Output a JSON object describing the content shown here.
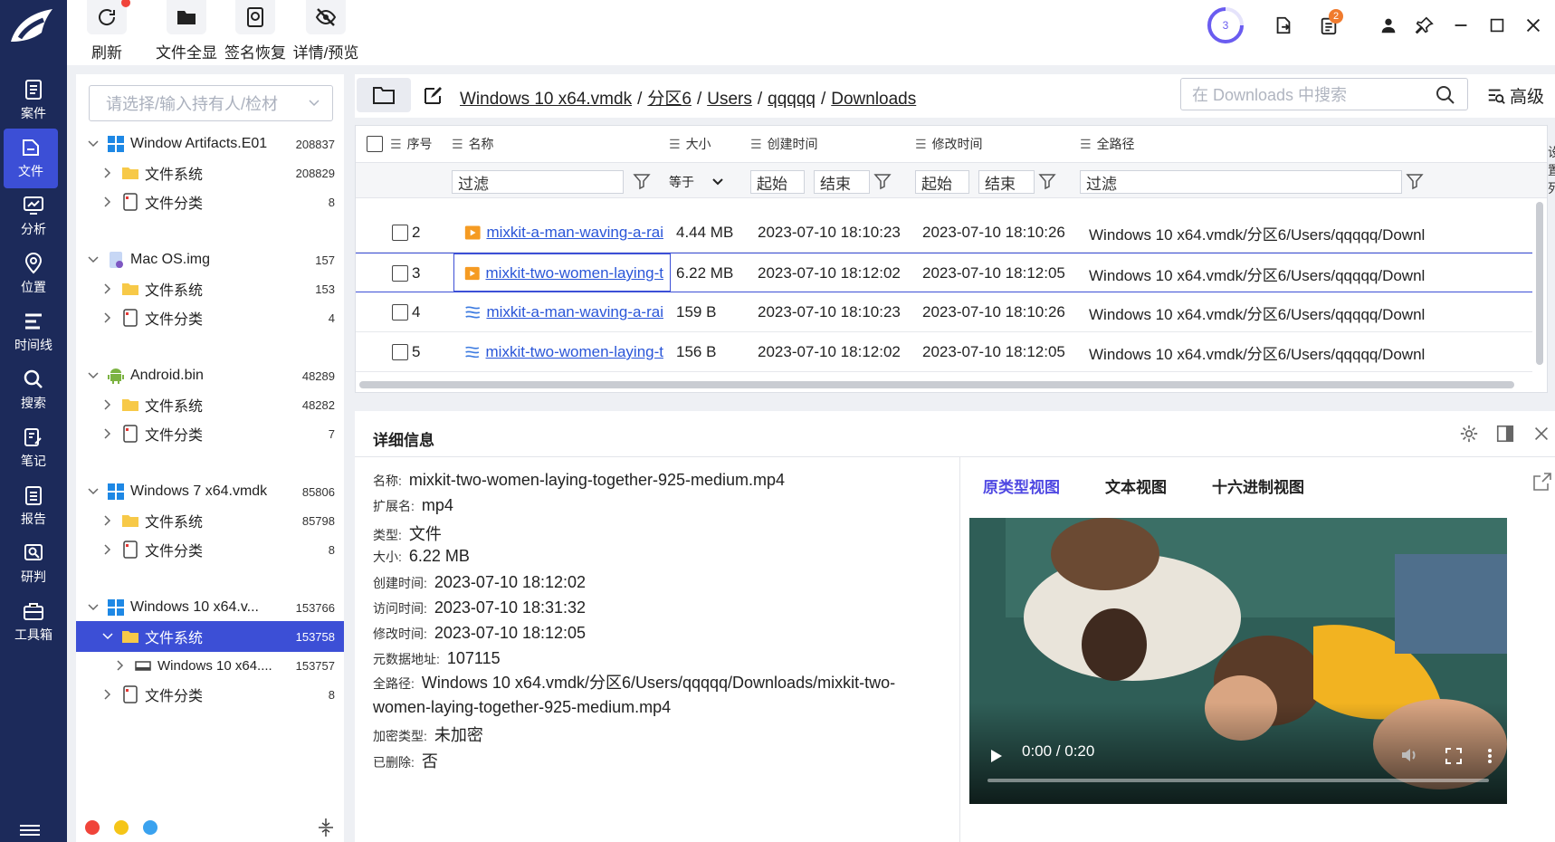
{
  "toolbar": {
    "refresh": "刷新",
    "file_full": "文件全显",
    "sign_restore": "签名恢复",
    "detail_preview": "详情/预览",
    "task_count": "3",
    "notify_count": "2"
  },
  "nav": {
    "items": [
      "案件",
      "文件",
      "分析",
      "位置",
      "时间线",
      "搜索",
      "笔记",
      "报告",
      "研判",
      "工具箱"
    ]
  },
  "tree": {
    "owner_placeholder": "请选择/输入持有人/检材",
    "nodes": [
      {
        "label": "Window Artifacts.E01",
        "count": "208837"
      },
      {
        "label": "文件系统",
        "count": "208829"
      },
      {
        "label": "文件分类",
        "count": "8"
      },
      {
        "label": "Mac OS.img",
        "count": "157"
      },
      {
        "label": "文件系统",
        "count": "153"
      },
      {
        "label": "文件分类",
        "count": "4"
      },
      {
        "label": "Android.bin",
        "count": "48289"
      },
      {
        "label": "文件系统",
        "count": "48282"
      },
      {
        "label": "文件分类",
        "count": "7"
      },
      {
        "label": "Windows 7 x64.vmdk",
        "count": "85806"
      },
      {
        "label": "文件系统",
        "count": "85798"
      },
      {
        "label": "文件分类",
        "count": "8"
      },
      {
        "label": "Windows 10 x64.v...",
        "count": "153766"
      },
      {
        "label": "文件系统",
        "count": "153758"
      },
      {
        "label": "Windows 10 x64....",
        "count": "153757"
      },
      {
        "label": "文件分类",
        "count": "8"
      }
    ]
  },
  "path": {
    "crumbs": [
      "Windows 10 x64.vmdk",
      "分区6",
      "Users",
      "qqqqq",
      "Downloads"
    ],
    "search_placeholder": "在 Downloads 中搜索",
    "advanced": "高级"
  },
  "table": {
    "headers": {
      "index": "序号",
      "name": "名称",
      "size": "大小",
      "created": "创建时间",
      "modified": "修改时间",
      "fullpath": "全路径"
    },
    "filter": {
      "placeholder": "过滤",
      "eq": "等于",
      "start": "起始",
      "end": "结束"
    },
    "rows": [
      {
        "index": "2",
        "name": "mixkit-a-man-waving-a-rai",
        "size": "4.44 MB",
        "created": "2023-07-10 18:10:23",
        "modified": "2023-07-10 18:10:26",
        "path": "Windows 10 x64.vmdk/分区6/Users/qqqqq/Downlo..."
      },
      {
        "index": "3",
        "name": "mixkit-two-women-laying-t",
        "size": "6.22 MB",
        "created": "2023-07-10 18:12:02",
        "modified": "2023-07-10 18:12:05",
        "path": "Windows 10 x64.vmdk/分区6/Users/qqqqq/Downlo..."
      },
      {
        "index": "4",
        "name": "mixkit-a-man-waving-a-rai",
        "size": "159 B",
        "created": "2023-07-10 18:10:23",
        "modified": "2023-07-10 18:10:26",
        "path": "Windows 10 x64.vmdk/分区6/Users/qqqqq/Downlo..."
      },
      {
        "index": "5",
        "name": "mixkit-two-women-laying-t",
        "size": "156 B",
        "created": "2023-07-10 18:12:02",
        "modified": "2023-07-10 18:12:05",
        "path": "Windows 10 x64.vmdk/分区6/Users/qqqqq/Downlo..."
      }
    ],
    "side_label": "设置列"
  },
  "detail": {
    "title": "详细信息",
    "name_k": "名称:",
    "name_v": "mixkit-two-women-laying-together-925-medium.mp4",
    "ext_k": "扩展名:",
    "ext_v": "mp4",
    "type_k": "类型:",
    "type_v": "文件",
    "size_k": "大小:",
    "size_v": "6.22 MB",
    "created_k": "创建时间:",
    "created_v": "2023-07-10 18:12:02",
    "accessed_k": "访问时间:",
    "accessed_v": "2023-07-10 18:31:32",
    "modified_k": "修改时间:",
    "modified_v": "2023-07-10 18:12:05",
    "meta_k": "元数据地址:",
    "meta_v": "107115",
    "path_k": "全路径:",
    "path_v": "Windows 10 x64.vmdk/分区6/Users/qqqqq/Downloads/mixkit-two-women-laying-together-925-medium.mp4",
    "enc_k": "加密类型:",
    "enc_v": "未加密",
    "del_k": "已删除:",
    "del_v": "否",
    "tab_native": "原类型视图",
    "tab_text": "文本视图",
    "tab_hex": "十六进制视图",
    "video_time": "0:00 / 0:20"
  },
  "colors": {
    "nav_bg": "#1c2a5a",
    "accent": "#3c4fd6",
    "link": "#2a56d8"
  }
}
